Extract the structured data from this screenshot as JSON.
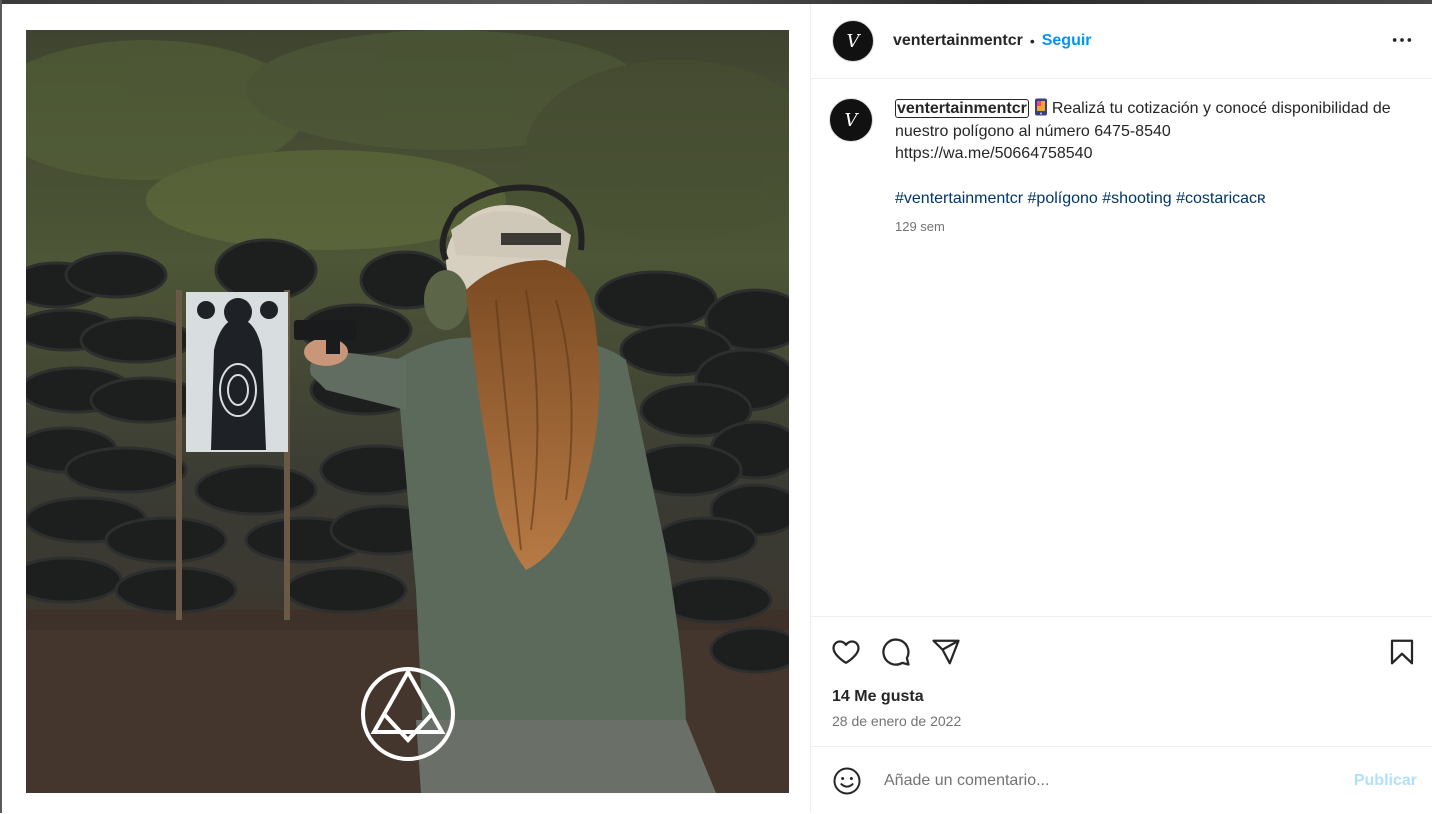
{
  "post": {
    "author": {
      "username": "ventertainmentcr",
      "avatar_initial": "V"
    },
    "follow_label": "Seguir",
    "separator": "•",
    "caption": {
      "username": "ventertainmentcr",
      "line1": "Realizá tu cotización y conocé disponibilidad de nuestro polígono al número 6475-8540",
      "link": "https://wa.me/50664758540",
      "hashtags": [
        "#ventertainmentcr",
        "#polígono",
        "#shooting",
        "#costaricaᴄʀ"
      ],
      "time": "129 sem"
    },
    "likes": "14 Me gusta",
    "date": "28 de enero de 2022",
    "comment": {
      "placeholder": "Añade un comentario...",
      "submit_label": "Publicar"
    }
  },
  "colors": {
    "accent": "#0095f6",
    "hashtag": "#00376b",
    "muted": "#737373",
    "publish_disabled": "#b2dffc"
  },
  "icons": [
    "more-options-icon",
    "phone-emoji-icon",
    "heart-icon",
    "comment-icon",
    "share-icon",
    "bookmark-icon",
    "emoji-icon",
    "watermark-logo-icon"
  ]
}
